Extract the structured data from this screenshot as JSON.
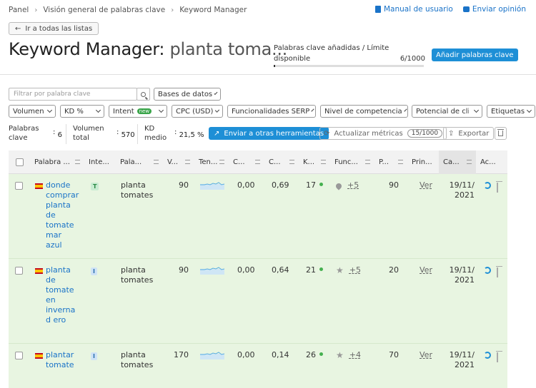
{
  "breadcrumb": [
    "Panel",
    "Visión general de palabras clave",
    "Keyword Manager"
  ],
  "top_links": {
    "manual": "Manual de usuario",
    "feedback": "Enviar opinión"
  },
  "back_button": "Ir a todas las listas",
  "title": {
    "main": "Keyword Manager:",
    "list": "planta toma..."
  },
  "limit": {
    "label": "Palabras clave añadidas / Límite disponible",
    "count": "6/1000",
    "progress_fraction": 0.006
  },
  "add_button": "Añadir palabras clave",
  "filter": {
    "placeholder": "Filtrar por palabra clave",
    "databases": "Bases de datos"
  },
  "filters": [
    "Volumen",
    "KD %",
    "Intent",
    "CPC (USD)",
    "Funcionalidades SERP",
    "Nivel de competencia",
    "Potencial de clic",
    "Etiquetas"
  ],
  "new_badge": "new",
  "stats": {
    "keywords_label": "Palabras clave",
    "keywords_value": "6",
    "volume_label": "Volumen total",
    "volume_value": "570",
    "kd_label": "KD medio",
    "kd_value": "21,5 %"
  },
  "actions": {
    "send": "Enviar a otras herramientas",
    "update": "Actualizar métricas",
    "update_count": "15/1000",
    "export": "Exportar"
  },
  "columns": [
    "Palabra ...",
    "Inte...",
    "Pala...",
    "V...",
    "Ten...",
    "C...",
    "C...",
    "K...",
    "Func...",
    "P...",
    "Prin...",
    "Ca...",
    "Ac..."
  ],
  "rows": [
    {
      "keyword": "donde comprar planta de tomate mar azul",
      "intent": "T",
      "parent": "planta tomates",
      "volume": "90",
      "cpc": "0,00",
      "com": "0,69",
      "kd": "17",
      "serp_icon": "pin-icon",
      "serp_more": "+5",
      "results": "90",
      "first_page": "Ver",
      "date": "19/11/ 2021"
    },
    {
      "keyword": "planta de tomate en invernad ero",
      "intent": "I",
      "parent": "planta tomates",
      "volume": "90",
      "cpc": "0,00",
      "com": "0,64",
      "kd": "21",
      "serp_icon": "star-icon",
      "serp_more": "+5",
      "results": "20",
      "first_page": "Ver",
      "date": "19/11/ 2021"
    },
    {
      "keyword": "plantar tomate",
      "intent": "I",
      "parent": "planta tomates",
      "volume": "170",
      "cpc": "0,00",
      "com": "0,14",
      "kd": "26",
      "serp_icon": "star-icon",
      "serp_more": "+4",
      "results": "70",
      "first_page": "Ver",
      "date": "19/11/ 2021"
    }
  ],
  "colors": {
    "accent": "#1e8fd6",
    "row_bg": "#e8f5e1",
    "kd_easy": "#45b04f"
  }
}
